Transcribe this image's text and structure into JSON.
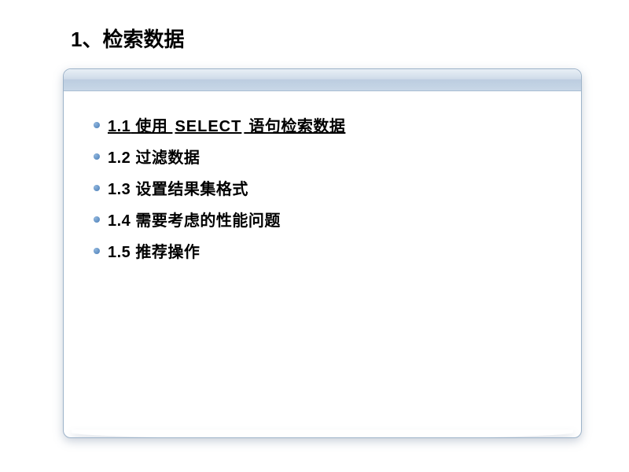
{
  "title": "1、检索数据",
  "items": [
    {
      "num": "1.1",
      "prefix": " 使用 ",
      "keyword": "SELECT",
      "suffix": " 语句检索数据",
      "active": true
    },
    {
      "num": "1.2",
      "prefix": " ",
      "keyword": "",
      "suffix": "过滤数据",
      "active": false
    },
    {
      "num": "1.3",
      "prefix": " ",
      "keyword": "",
      "suffix": "设置结果集格式",
      "active": false
    },
    {
      "num": "1.4",
      "prefix": " ",
      "keyword": "",
      "suffix": "需要考虑的性能问题",
      "active": false
    },
    {
      "num": "1.5",
      "prefix": " ",
      "keyword": "",
      "suffix": "推荐操作",
      "active": false
    }
  ]
}
